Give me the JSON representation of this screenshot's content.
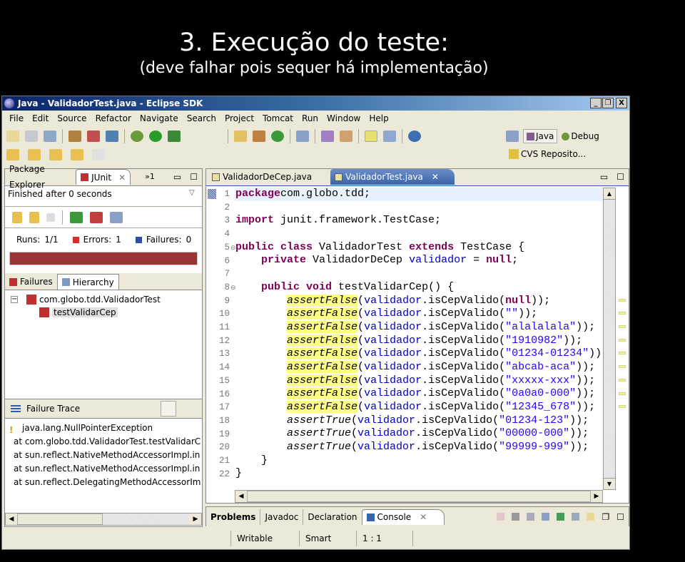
{
  "slide": {
    "title": "3. Execução do teste:",
    "subtitle": "(deve falhar pois sequer há implementação)"
  },
  "window": {
    "title": "Java - ValidadorTest.java - Eclipse SDK",
    "minimize": "_",
    "restore": "❐",
    "close": "X"
  },
  "menu": [
    "File",
    "Edit",
    "Source",
    "Refactor",
    "Navigate",
    "Search",
    "Project",
    "Tomcat",
    "Run",
    "Window",
    "Help"
  ],
  "perspectives": {
    "java": "Java",
    "debug": "Debug",
    "cvs": "CVS Reposito..."
  },
  "left_panel": {
    "tabs": {
      "package_explorer": "Package Explorer",
      "junit": "JUnit",
      "overflow": "»1"
    },
    "status": "Finished after 0 seconds",
    "runs_label": "Runs:",
    "runs": "1/1",
    "errors_label": "Errors:",
    "errors": "1",
    "failures_label": "Failures:",
    "failures": "0",
    "progress": {
      "fraction": 1.0,
      "color": "#9b3535"
    },
    "subtabs": {
      "failures": "Failures",
      "hierarchy": "Hierarchy"
    },
    "tree": {
      "suite": "com.globo.tdd.ValidadorTest",
      "test": "testValidarCep"
    },
    "trace_title": "Failure Trace",
    "trace": [
      "java.lang.NullPointerException",
      "at com.globo.tdd.ValidadorTest.testValidarCep",
      "at sun.reflect.NativeMethodAccessorImpl.invo",
      "at sun.reflect.NativeMethodAccessorImpl.invo",
      "at sun.reflect.DelegatingMethodAccessorImpl."
    ]
  },
  "editor": {
    "tabs": [
      "ValidadorDeCep.java",
      "ValidadorTest.java"
    ],
    "active_tab": 1,
    "lines": [
      [
        [
          "kw",
          "package"
        ],
        [
          "",
          "com.globo.tdd;"
        ]
      ],
      [],
      [
        [
          "kw",
          "import"
        ],
        [
          "",
          " junit.framework.TestCase;"
        ]
      ],
      [],
      [
        [
          "kw",
          "public class"
        ],
        [
          "",
          " ValidadorTest "
        ],
        [
          "kw",
          "extends"
        ],
        [
          "",
          " TestCase {"
        ]
      ],
      [
        [
          "",
          "    "
        ],
        [
          "kw",
          "private"
        ],
        [
          "",
          " ValidadorDeCep "
        ],
        [
          "fld",
          "validador"
        ],
        [
          "",
          " = "
        ],
        [
          "kw",
          "null"
        ],
        [
          "",
          ";"
        ]
      ],
      [],
      [
        [
          "",
          "    "
        ],
        [
          "kw",
          "public void"
        ],
        [
          "",
          " testValidarCep() {"
        ]
      ],
      [
        [
          "",
          "        "
        ],
        [
          "it hl",
          "assertFalse"
        ],
        [
          "",
          "("
        ],
        [
          "fld",
          "validador"
        ],
        [
          "",
          ".isCepValido("
        ],
        [
          "kw",
          "null"
        ],
        [
          "",
          "));"
        ]
      ],
      [
        [
          "",
          "        "
        ],
        [
          "it hl",
          "assertFalse"
        ],
        [
          "",
          "("
        ],
        [
          "fld",
          "validador"
        ],
        [
          "",
          ".isCepValido("
        ],
        [
          "str",
          "\"\""
        ],
        [
          "",
          "));"
        ]
      ],
      [
        [
          "",
          "        "
        ],
        [
          "it hl",
          "assertFalse"
        ],
        [
          "",
          "("
        ],
        [
          "fld",
          "validador"
        ],
        [
          "",
          ".isCepValido("
        ],
        [
          "str",
          "\"alalalala\""
        ],
        [
          "",
          "));"
        ]
      ],
      [
        [
          "",
          "        "
        ],
        [
          "it hl",
          "assertFalse"
        ],
        [
          "",
          "("
        ],
        [
          "fld",
          "validador"
        ],
        [
          "",
          ".isCepValido("
        ],
        [
          "str",
          "\"1910982\""
        ],
        [
          "",
          "));"
        ]
      ],
      [
        [
          "",
          "        "
        ],
        [
          "it hl",
          "assertFalse"
        ],
        [
          "",
          "("
        ],
        [
          "fld",
          "validador"
        ],
        [
          "",
          ".isCepValido("
        ],
        [
          "str",
          "\"01234-01234\""
        ],
        [
          "",
          "));"
        ]
      ],
      [
        [
          "",
          "        "
        ],
        [
          "it hl",
          "assertFalse"
        ],
        [
          "",
          "("
        ],
        [
          "fld",
          "validador"
        ],
        [
          "",
          ".isCepValido("
        ],
        [
          "str",
          "\"abcab-aca\""
        ],
        [
          "",
          "));"
        ]
      ],
      [
        [
          "",
          "        "
        ],
        [
          "it hl",
          "assertFalse"
        ],
        [
          "",
          "("
        ],
        [
          "fld",
          "validador"
        ],
        [
          "",
          ".isCepValido("
        ],
        [
          "str",
          "\"xxxxx-xxx\""
        ],
        [
          "",
          "));"
        ]
      ],
      [
        [
          "",
          "        "
        ],
        [
          "it hl",
          "assertFalse"
        ],
        [
          "",
          "("
        ],
        [
          "fld",
          "validador"
        ],
        [
          "",
          ".isCepValido("
        ],
        [
          "str",
          "\"0a0a0-000\""
        ],
        [
          "",
          "));"
        ]
      ],
      [
        [
          "",
          "        "
        ],
        [
          "it hl",
          "assertFalse"
        ],
        [
          "",
          "("
        ],
        [
          "fld",
          "validador"
        ],
        [
          "",
          ".isCepValido("
        ],
        [
          "str",
          "\"12345_678\""
        ],
        [
          "",
          "));"
        ]
      ],
      [
        [
          "",
          "        "
        ],
        [
          "it",
          "assertTrue"
        ],
        [
          "",
          "("
        ],
        [
          "fld",
          "validador"
        ],
        [
          "",
          ".isCepValido("
        ],
        [
          "str",
          "\"01234-123\""
        ],
        [
          "",
          "));"
        ]
      ],
      [
        [
          "",
          "        "
        ],
        [
          "it",
          "assertTrue"
        ],
        [
          "",
          "("
        ],
        [
          "fld",
          "validador"
        ],
        [
          "",
          ".isCepValido("
        ],
        [
          "str",
          "\"00000-000\""
        ],
        [
          "",
          "));"
        ]
      ],
      [
        [
          "",
          "        "
        ],
        [
          "it",
          "assertTrue"
        ],
        [
          "",
          "("
        ],
        [
          "fld",
          "validador"
        ],
        [
          "",
          ".isCepValido("
        ],
        [
          "str",
          "\"99999-999\""
        ],
        [
          "",
          "));"
        ]
      ],
      [
        [
          "",
          "    }"
        ]
      ],
      [
        [
          "",
          "}"
        ]
      ]
    ]
  },
  "bottom_panel": {
    "tabs": [
      "Problems",
      "Javadoc",
      "Declaration",
      "Console"
    ]
  },
  "statusbar": {
    "writable": "Writable",
    "insert_mode": "Smart Insert",
    "position": "1 : 1"
  }
}
